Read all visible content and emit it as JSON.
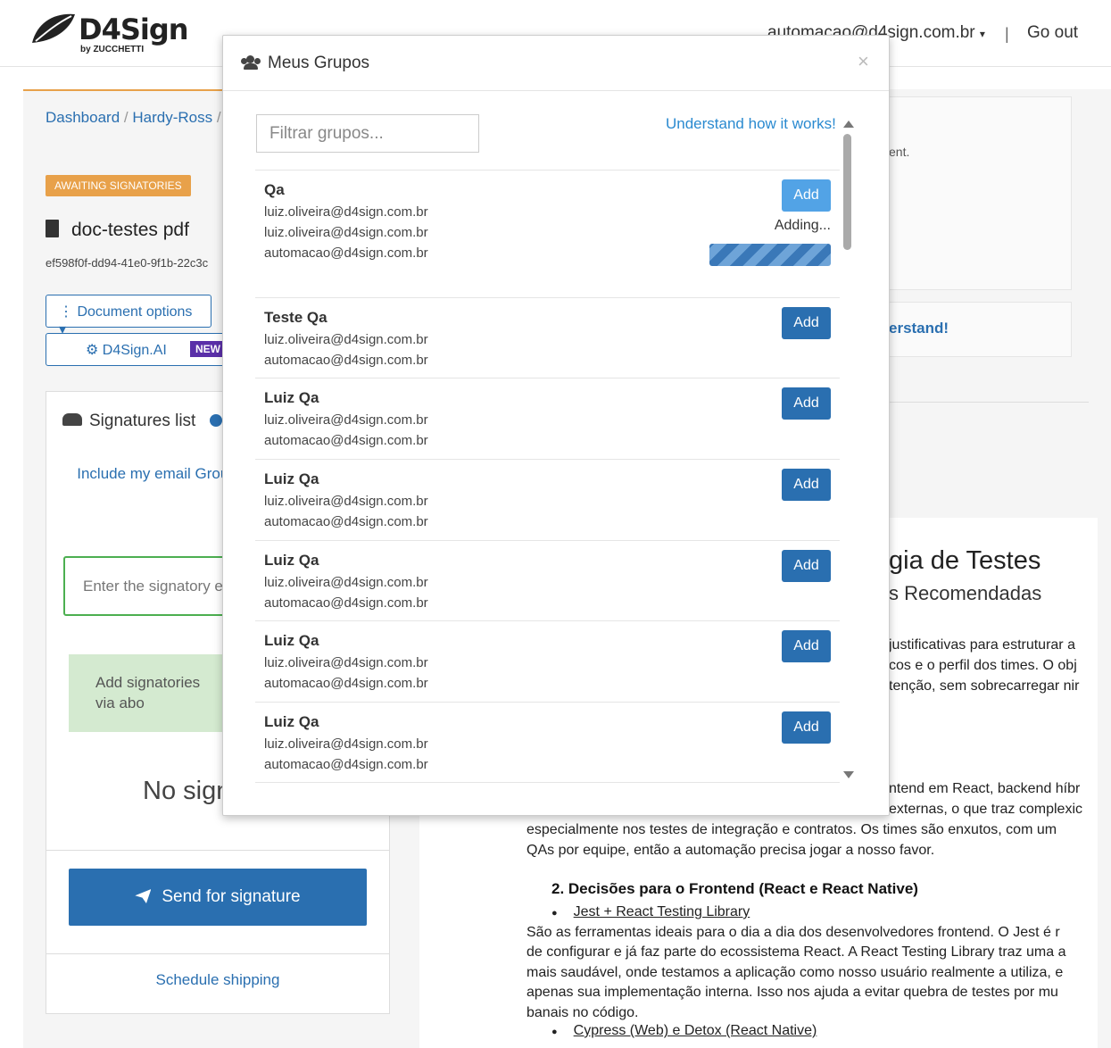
{
  "app": {
    "logo_text": "D4Sign",
    "logo_sub": "by ZUCCHETTI",
    "user_email": "automacao@d4sign.com.br",
    "separator": "|",
    "go_out": "Go out"
  },
  "breadcrumb": {
    "items": [
      "Dashboard",
      "Hardy-Ross"
    ],
    "separator": "/"
  },
  "document": {
    "status": "AWAITING SIGNATORIES",
    "title": "doc-testes pdf",
    "hash": "ef598f0f-dd94-41e0-9f1b-22c3c",
    "options_label": "Document options",
    "ai_label": "D4Sign.AI",
    "new_badge": "NEW"
  },
  "signatures": {
    "title": "Signatures list",
    "include_link": "Include my email Group",
    "input_placeholder": "Enter the signatory e",
    "green_text": "Add signatories via abo",
    "no_sig": "No sign",
    "send_label": "Send for signature",
    "schedule_label": "Schedule shipping"
  },
  "right": {
    "info_fragment": "ent.",
    "understand": "erstand!",
    "doc_h1": "gia de Testes",
    "doc_h2": "s Recomendadas",
    "frag_lines": [
      "justificativas para estruturar a",
      "cos e o perfil dos times. O obj",
      "tenção, sem sobrecarregar nir"
    ],
    "frag_line4": "ntend em React, backend híbr",
    "frag_line5": "externas, o que traz complexic",
    "lines": [
      "especialmente nos testes de integração e contratos. Os times são enxutos, com um",
      "QAs por equipe, então a automação precisa jogar a nosso favor."
    ],
    "section": "2.  Decisões para o Frontend (React e React Native)",
    "bullet1": "Jest + React Testing Library",
    "para": [
      "São as ferramentas ideais para o dia a dia dos desenvolvedores frontend. O Jest é r",
      "de configurar e já faz parte do ecossistema React. A React Testing Library traz uma a",
      "mais saudável, onde testamos a aplicação como nosso usuário realmente a utiliza, e",
      "apenas sua implementação interna. Isso nos ajuda a evitar quebra de testes por mu",
      "banais no código."
    ],
    "bullet2": "Cypress (Web) e Detox (React Native)"
  },
  "modal": {
    "title": "Meus Grupos",
    "close": "×",
    "filter_placeholder": "Filtrar grupos...",
    "how_link": "Understand how it works!",
    "add_label": "Add",
    "adding_text": "Adding...",
    "bullet_char": "●",
    "groups": [
      {
        "name": "Qa",
        "emails": [
          "luiz.oliveira@d4sign.com.br",
          "luiz.oliveira@d4sign.com.br",
          "automacao@d4sign.com.br"
        ],
        "state": "adding"
      },
      {
        "name": "Teste Qa",
        "emails": [
          "luiz.oliveira@d4sign.com.br",
          "automacao@d4sign.com.br"
        ]
      },
      {
        "name": "Luiz Qa",
        "emails": [
          "luiz.oliveira@d4sign.com.br",
          "automacao@d4sign.com.br"
        ]
      },
      {
        "name": "Luiz Qa",
        "emails": [
          "luiz.oliveira@d4sign.com.br",
          "automacao@d4sign.com.br"
        ]
      },
      {
        "name": "Luiz Qa",
        "emails": [
          "luiz.oliveira@d4sign.com.br",
          "automacao@d4sign.com.br"
        ]
      },
      {
        "name": "Luiz Qa",
        "emails": [
          "luiz.oliveira@d4sign.com.br",
          "automacao@d4sign.com.br"
        ]
      },
      {
        "name": "Luiz Qa",
        "emails": [
          "luiz.oliveira@d4sign.com.br",
          "automacao@d4sign.com.br"
        ]
      }
    ]
  },
  "colors": {
    "primary": "#2a6fb0",
    "accent": "#e8a14a",
    "link": "#2a8ad0"
  }
}
